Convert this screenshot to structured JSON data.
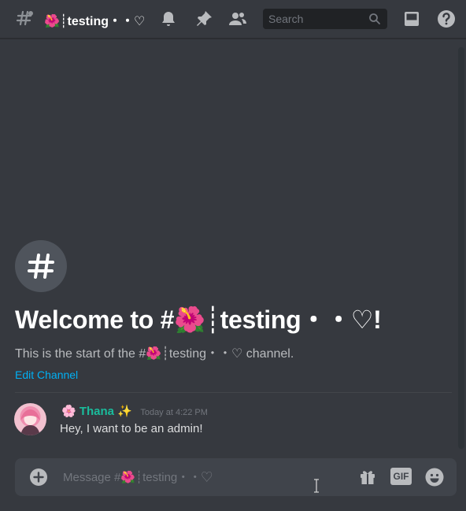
{
  "header": {
    "channel_title": "🌺┊testing・・♡",
    "search_placeholder": "Search",
    "icons": [
      "threads-icon",
      "bell-icon",
      "pin-icon",
      "members-icon",
      "search-icon",
      "inbox-icon",
      "help-icon"
    ]
  },
  "channel_intro": {
    "welcome": "Welcome to #🌺┊testing・・♡!",
    "start_text": "This is the start of the #🌺┊testing・・♡ channel.",
    "edit_label": "Edit Channel"
  },
  "message": {
    "username": "🌸 Thana ✨",
    "timestamp": "Today at 4:22 PM",
    "text": "Hey, I want to be an admin!"
  },
  "composer": {
    "placeholder": "Message #🌺┊testing・・♡",
    "gif_label": "GIF"
  },
  "colors": {
    "background": "#36393f",
    "username": "#1abc9c",
    "link": "#00b0f4",
    "composer": "#40444b"
  }
}
